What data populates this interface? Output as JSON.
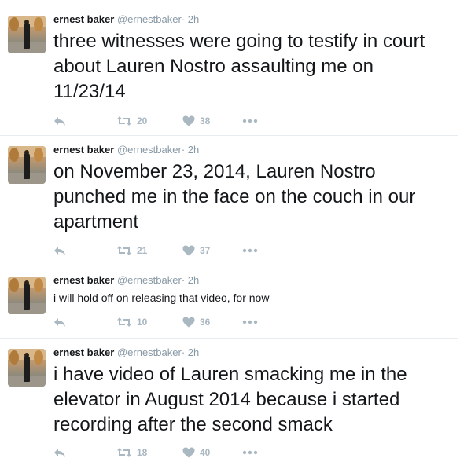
{
  "tweets": [
    {
      "name": "ernest baker",
      "handle": "@ernestbaker",
      "separator": "·",
      "time": "2h",
      "text": "three witnesses were going to testify in court about Lauren Nostro assaulting me on 11/23/14",
      "retweets": "20",
      "likes": "38"
    },
    {
      "name": "ernest baker",
      "handle": "@ernestbaker",
      "separator": "·",
      "time": "2h",
      "text": "on November 23, 2014, Lauren Nostro punched me in the face on the couch in our apartment",
      "retweets": "21",
      "likes": "37"
    },
    {
      "name": "ernest baker",
      "handle": "@ernestbaker",
      "separator": "·",
      "time": "2h",
      "text": "i will hold off on releasing that video, for now",
      "retweets": "10",
      "likes": "36"
    },
    {
      "name": "ernest baker",
      "handle": "@ernestbaker",
      "separator": "·",
      "time": "2h",
      "text": "i have video of Lauren smacking me in the elevator in August 2014 because i started recording after the second smack",
      "retweets": "18",
      "likes": "40"
    }
  ],
  "icons": {
    "reply": "reply-icon",
    "retweet": "retweet-icon",
    "like": "heart-icon",
    "more": "more-icon"
  },
  "colors": {
    "text": "#14171a",
    "secondary": "#8899a6",
    "action": "#aab8c2",
    "border": "#e6ecf0"
  }
}
